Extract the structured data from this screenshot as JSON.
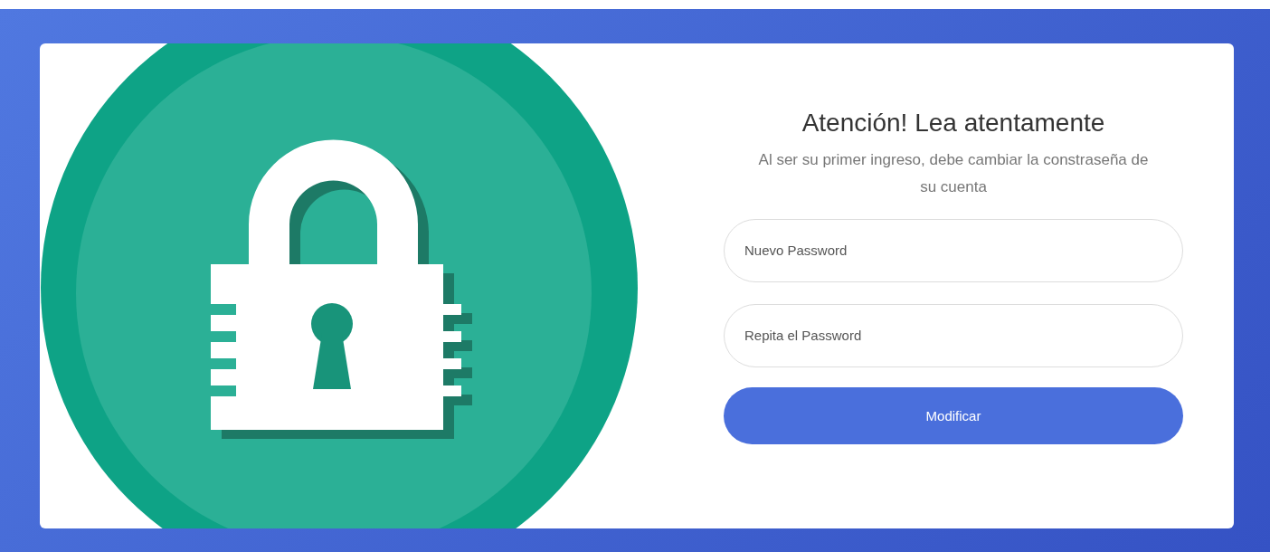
{
  "heading": "Atención! Lea atentamente",
  "message": "Al ser su primer ingreso, debe cambiar la constraseña de su cuenta",
  "fields": [
    {
      "placeholder": "Nuevo Password"
    },
    {
      "placeholder": "Repita el Password"
    }
  ],
  "submit_button": "Modificar"
}
